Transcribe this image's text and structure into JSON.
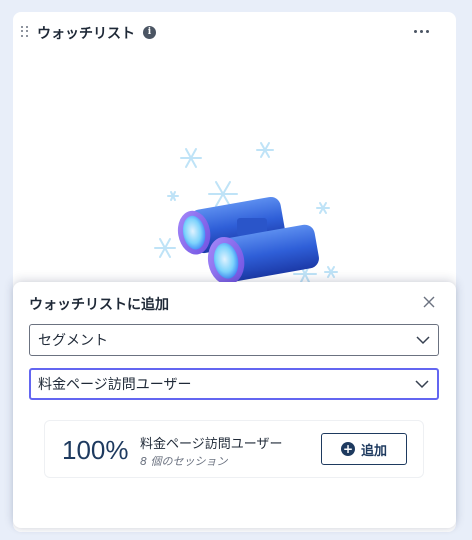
{
  "card": {
    "title": "ウォッチリスト",
    "info_icon": "info-icon",
    "more_icon": "ellipsis-icon",
    "illustration": "binoculars-icon"
  },
  "popover": {
    "title": "ウォッチリストに追加",
    "close_icon": "close-icon",
    "segment_select": {
      "value": "セグメント"
    },
    "audience_select": {
      "value": "料金ページ訪問ユーザー"
    },
    "result": {
      "percent": "100%",
      "name": "料金ページ訪問ユーザー",
      "sub": "8 個のセッション",
      "add_label": "追加"
    }
  },
  "colors": {
    "accent": "#6366f1",
    "primary_dark": "#1e3a5f",
    "background": "#e8eef9"
  }
}
